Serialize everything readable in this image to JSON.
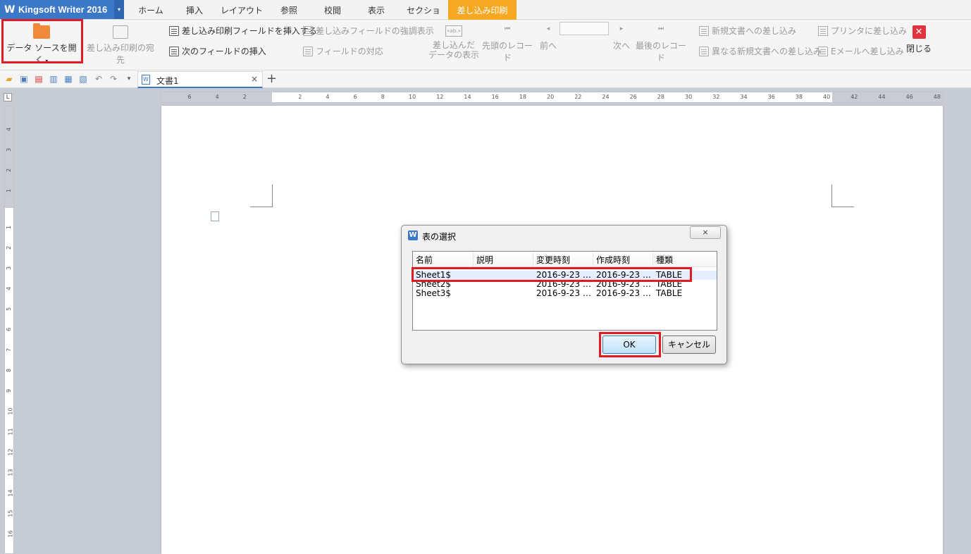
{
  "app": {
    "logo": "W",
    "name": "Kingsoft Writer 2016",
    "menu_arrow": "▾"
  },
  "tabs": [
    {
      "label": "ホーム"
    },
    {
      "label": "挿入"
    },
    {
      "label": "レイアウト"
    },
    {
      "label": "参照"
    },
    {
      "label": "校閲"
    },
    {
      "label": "表示"
    },
    {
      "label": "セクション"
    },
    {
      "label": "差し込み印刷"
    }
  ],
  "ribbon": {
    "open_data_source": "データ ソースを開く",
    "mail_recipients": "差し込み印刷の宛先",
    "insert_merge_field": "差し込み印刷フィールドを挿入する",
    "highlight_fields": "差し込みフィールドの強調表示",
    "insert_next_field": "次のフィールドの挿入",
    "match_fields": "フィールドの対応",
    "view_merged_line1": "差し込んだ",
    "view_merged_line2": "データの表示",
    "first_record": "先頭のレコード",
    "prev": "前へ",
    "next": "次へ",
    "last_record": "最後のレコード",
    "merge_new_doc": "新規文書への差し込み",
    "merge_diff_new_doc": "異なる新規文書への差し込み",
    "merge_printer": "プリンタに差し込み",
    "merge_email": "Eメールへ差し込み",
    "close": "閉じる",
    "record_value": ""
  },
  "doc_tab": {
    "label": "文書1",
    "close": "×",
    "new": "+"
  },
  "ruler": {
    "h_left": [
      "6",
      "4",
      "2"
    ],
    "h_right": [
      "2",
      "4",
      "6",
      "8",
      "10",
      "12",
      "14",
      "16",
      "18",
      "20",
      "22",
      "24",
      "26",
      "28",
      "30",
      "32",
      "34",
      "36",
      "38",
      "40",
      "42",
      "44",
      "46",
      "48"
    ],
    "v_top": [
      "4",
      "3",
      "2",
      "1"
    ],
    "v_bottom": [
      "1",
      "2",
      "3",
      "4",
      "5",
      "6",
      "7",
      "8",
      "9",
      "10",
      "11",
      "12",
      "13",
      "14",
      "15",
      "16"
    ],
    "corner": "L"
  },
  "dialog": {
    "icon": "W",
    "title": "表の選択",
    "close": "⨯",
    "columns": [
      "名前",
      "説明",
      "変更時刻",
      "作成時刻",
      "種類"
    ],
    "rows": [
      {
        "name": "Sheet1$",
        "desc": "",
        "modified": "2016-9-23 …",
        "created": "2016-9-23 …",
        "type": "TABLE"
      },
      {
        "name": "Sheet2$",
        "desc": "",
        "modified": "2016-9-23 …",
        "created": "2016-9-23 …",
        "type": "TABLE"
      },
      {
        "name": "Sheet3$",
        "desc": "",
        "modified": "2016-9-23 …",
        "created": "2016-9-23 …",
        "type": "TABLE"
      }
    ],
    "ok": "OK",
    "cancel": "キャンセル"
  },
  "colors": {
    "accent": "#3b78c8",
    "active_tab": "#f7a823",
    "highlight": "#e01b23"
  }
}
